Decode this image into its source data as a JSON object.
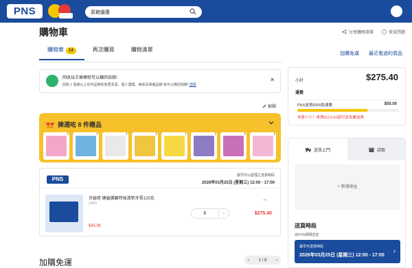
{
  "header": {
    "logo": "PNS",
    "search_value": "原箱優惠"
  },
  "page": {
    "title": "購物車",
    "share_label": "分享購物清單",
    "faq_label": "常見問題"
  },
  "tabs": [
    {
      "label": "購物車",
      "count": "14"
    },
    {
      "label": "再次購買"
    },
    {
      "label": "購物清單"
    }
  ],
  "right_links": {
    "free_shipping": "加購免運",
    "recently_viewed": "最近看過的貨品"
  },
  "notice": {
    "title": "回收玩王樂樽就可以賺回佰啲!",
    "body": "回收 1 個或以上任何品牌的家居清潔、個人護理、美妝及保健品樽 就可以賺回佰啲!",
    "link": "詳情"
  },
  "edit_label": "編輯",
  "gift": {
    "title": "揀選咗 8 件贈品",
    "items": [
      {
        "count": "1",
        "color": "#f3a6c8"
      },
      {
        "count": "1",
        "color": "#6fb3e0"
      },
      {
        "count": "1",
        "color": "#e9e9e9"
      },
      {
        "count": "1",
        "color": "#f0c640"
      },
      {
        "count": "1",
        "color": "#f5d942"
      },
      {
        "count": "1",
        "color": "#8e7cc3"
      },
      {
        "count": "1",
        "color": "#c86fb8"
      },
      {
        "count": "1",
        "color": "#f2b7d3"
      }
    ]
  },
  "store": {
    "name": "PNS",
    "ship_label": "最早可以處理之送貨時段",
    "ship_date": "2026年03月25日 (星期三) 12:00 - 17:00",
    "product": {
      "name": "牙齒佬 健齒護齦特強清新牙膏120克",
      "size": "120G",
      "price": "$45.90",
      "qty": "6",
      "dash": "--",
      "total": "$275.40"
    }
  },
  "section2": {
    "title": "加購免運",
    "pager": "1 / 8"
  },
  "summary": {
    "subtotal_label": "小計",
    "subtotal": "$275.40",
    "shipping_label": "運費",
    "free_shipping_label": "PNS送貨$399免運費",
    "free_shipping_value": "$50.00",
    "progress": 0.69,
    "warning": "仲差少少！再買$123.60就可享免費送貨"
  },
  "delivery": {
    "tab_home": "送貨上門",
    "tab_pickup": "店取",
    "add_address": "+ 新增地址",
    "time_title": "送貨時段",
    "time_sub": "由PNS網購送送",
    "slot_label": "最早可送貨時段",
    "slot_value": "2026年03月25日 (星期三) 12:00 - 17:00"
  },
  "colors": {
    "brand": "#1a4b9c",
    "accent": "#f5c400",
    "price": "#e5393a"
  }
}
